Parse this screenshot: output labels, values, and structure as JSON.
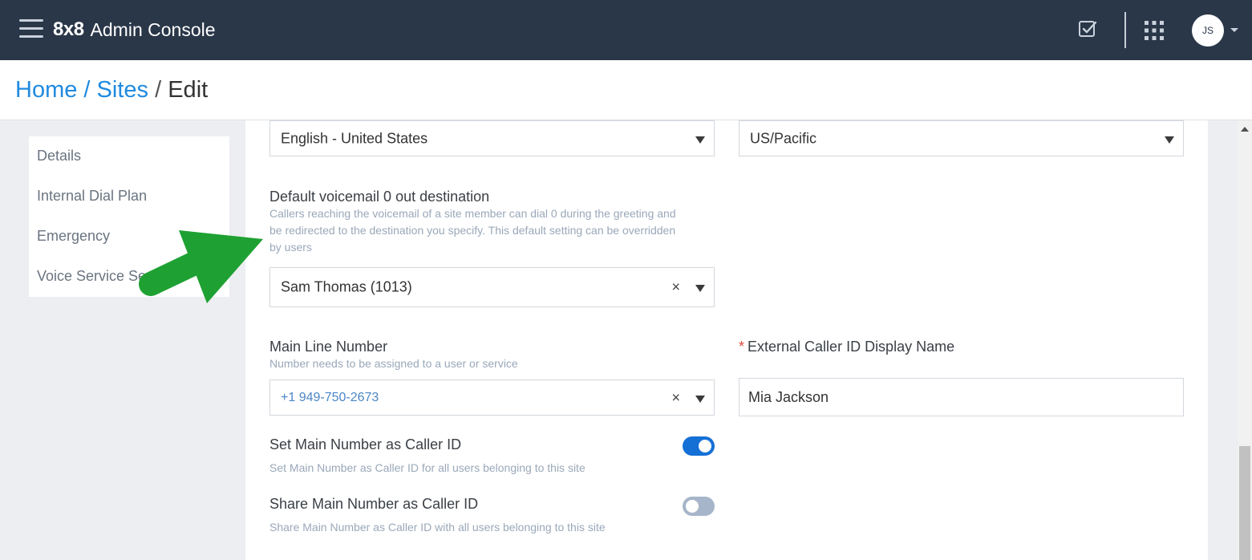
{
  "header": {
    "brand_logo": "8x8",
    "brand_title": "Admin Console",
    "user_initials": "JS",
    "icons": [
      "menu-icon",
      "tasks-icon",
      "apps-grid-icon",
      "caret-down-icon"
    ]
  },
  "breadcrumb": {
    "home": "Home",
    "sites": "Sites",
    "current": "Edit",
    "separator": "/"
  },
  "sidenav": {
    "items": [
      {
        "label": "Details"
      },
      {
        "label": "Internal Dial Plan"
      },
      {
        "label": "Emergency"
      },
      {
        "label": "Voice Service Se"
      }
    ]
  },
  "form": {
    "language": {
      "value": "English - United States"
    },
    "timezone": {
      "value": "US/Pacific"
    },
    "voicemail": {
      "label": "Default voicemail 0 out destination",
      "help_lines": [
        "Callers reaching the voicemail of a site member can dial 0 during the greeting and",
        "be redirected to the destination you specify. This default setting can be overridden",
        "by users"
      ],
      "value": "Sam Thomas (1013)"
    },
    "main_line": {
      "label": "Main Line Number",
      "help": "Number needs to be assigned to a user or service",
      "value": "+1 949-750-2673"
    },
    "caller_id_name": {
      "required_mark": "*",
      "label": "External Caller ID Display Name",
      "value": "Mia Jackson"
    },
    "set_main_number": {
      "label": "Set Main Number as Caller ID",
      "help": "Set Main Number as Caller ID for all users belonging to this site",
      "enabled": true
    },
    "share_main_number": {
      "label": "Share Main Number as Caller ID",
      "help": "Share Main Number as Caller ID with all users belonging to this site",
      "enabled": false
    },
    "clear_symbol": "×"
  },
  "colors": {
    "topbar": "#2a3749",
    "link": "#1f8ae0",
    "toggle_on": "#1570d6",
    "toggle_off": "#a6b5c9",
    "annotation_arrow": "#1ea132"
  }
}
